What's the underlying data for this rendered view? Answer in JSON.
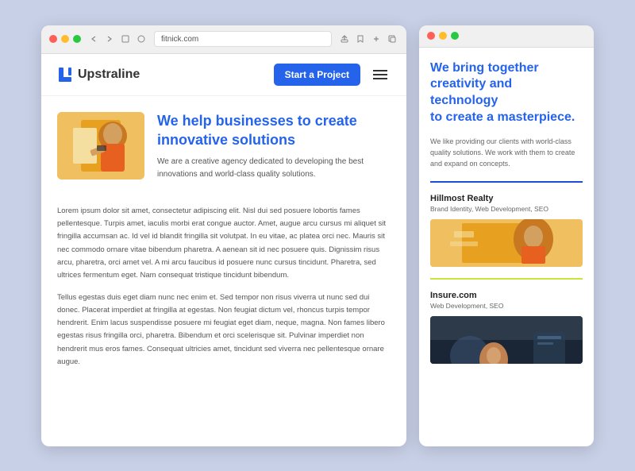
{
  "desktop": {
    "addressBar": "fitnick.com",
    "nav": {
      "logo": "Upstraline",
      "cta": "Start a Project"
    },
    "hero": {
      "headline": "We help businesses to create innovative solutions",
      "subtext": "We are a creative agency dedicated to developing the best innovations and world-class quality solutions."
    },
    "body1": "Lorem ipsum dolor sit amet, consectetur adipiscing elit. Nisl dui sed posuere lobortis fames pellentesque. Turpis amet, iaculis morbi erat congue auctor. Amet, augue arcu cursus mi aliquet sit fringilla accumsan ac. Id vel id blandit fringilla sit volutpat. In eu vitae, ac platea orci nec. Mauris sit nec commodo ornare vitae bibendum pharetra. A aenean sit id nec posuere quis. Dignissim risus arcu, pharetra, orci amet vel. A mi arcu faucibus id posuere nunc cursus tincidunt. Pharetra, sed ultrices fermentum eget. Nam consequat tristique tincidunt bibendum.",
    "body2": "Tellus egestas duis eget diam nunc nec enim et. Sed tempor non risus viverra ut nunc sed dui donec. Placerat imperdiet at fringilla at egestas. Non feugiat dictum vel, rhoncus turpis tempor hendrerit. Enim lacus suspendisse posuere mi feugiat eget diam, neque, magna. Non fames libero egestas risus fringilla orci, pharetra. Bibendum et orci scelerisque sit. Pulvinar imperdiet non hendrerit mus eros fames. Consequat ultricies amet, tincidunt sed viverra nec pellentesque ornare augue."
  },
  "mobile": {
    "headline1": "We bring together",
    "headline2": "creativity and technology",
    "headline3": "to create a masterpiece.",
    "subtext": "We like providing our clients with world-class quality solutions. We work with them to create and expand on concepts.",
    "projects": [
      {
        "name": "Hillmost Realty",
        "tags": "Brand Identity, Web Development, SEO"
      },
      {
        "name": "Insure.com",
        "tags": "Web Development, SEO"
      }
    ]
  }
}
